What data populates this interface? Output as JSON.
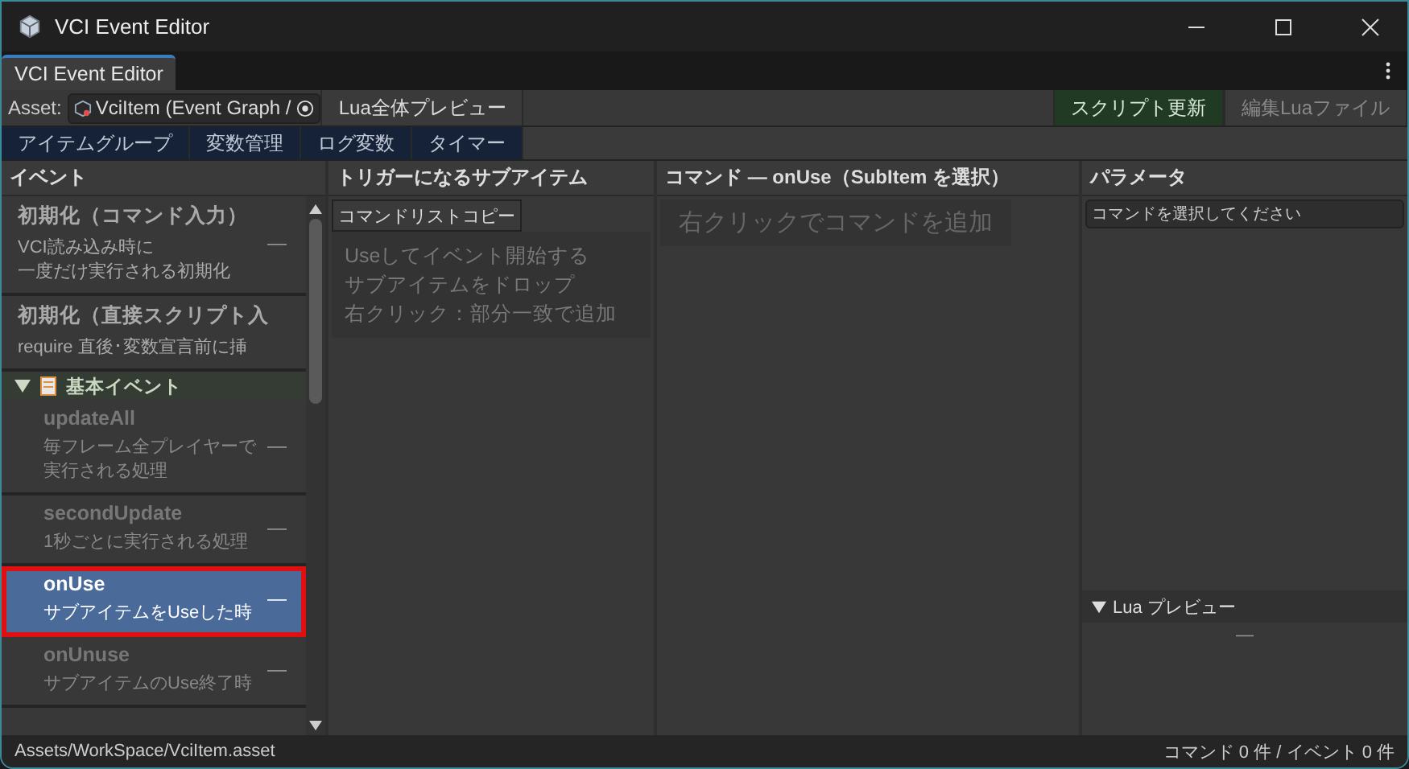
{
  "window": {
    "title": "VCI Event Editor"
  },
  "tab": {
    "label": "VCI Event Editor",
    "selected": true
  },
  "asset_bar": {
    "label": "Asset:",
    "value": "VciItem (Event Graph /",
    "preview_button": "Lua全体プレビュー",
    "update_button": "スクリプト更新",
    "edit_button": "編集Luaファイル"
  },
  "tabs": [
    {
      "label": "アイテムグループ",
      "selected": false
    },
    {
      "label": "変数管理",
      "selected": false
    },
    {
      "label": "ログ変数",
      "selected": false
    },
    {
      "label": "タイマー",
      "selected": false
    }
  ],
  "events": {
    "header": "イベント",
    "items": [
      {
        "kind": "event",
        "title": "初期化（コマンド入力）",
        "description": [
          "VCI読み込み時に",
          "一度だけ実行される初期化"
        ],
        "action": "—",
        "selected": false
      },
      {
        "kind": "event",
        "title": "初期化（直接スクリプト入",
        "description": [
          "require 直後･変数宣言前に挿"
        ],
        "selected": false
      },
      {
        "kind": "category",
        "title": "基本イベント",
        "expanded": true,
        "children": [
          {
            "kind": "event",
            "title": "updateAll",
            "description": [
              "毎フレーム全プレイヤーで",
              "実行される処理"
            ],
            "action": "—",
            "selected": false
          },
          {
            "kind": "event",
            "title": "secondUpdate",
            "description": [
              "1秒ごとに実行される処理"
            ],
            "action": "—",
            "selected": false
          },
          {
            "kind": "event",
            "title": "onUse",
            "description": [
              "サブアイテムをUseした時"
            ],
            "action": "—",
            "selected": true,
            "outlined": true
          },
          {
            "kind": "event",
            "title": "onUnuse",
            "description": [
              "サブアイテムのUse終了時"
            ],
            "action": "—",
            "selected": false
          }
        ]
      }
    ]
  },
  "triggers": {
    "header": "トリガーになるサブアイテム",
    "copy_button": "コマンドリストコピー",
    "drop_hint": [
      "Useしてイベント開始する",
      "サブアイテムをドロップ",
      "右クリック：部分一致で追加"
    ]
  },
  "commands": {
    "header": "コマンド — onUse（SubItem を選択）",
    "hint": "右クリックでコマンドを追加"
  },
  "parameters": {
    "header": "パラメータ",
    "placeholder": "コマンドを選択してください",
    "lua_preview": {
      "label": "Lua プレビュー",
      "expanded": true,
      "content": "—"
    }
  },
  "status_bar": {
    "path": "Assets/WorkSpace/VciItem.asset",
    "counts": "コマンド 0 件 / イベント 0 件"
  }
}
